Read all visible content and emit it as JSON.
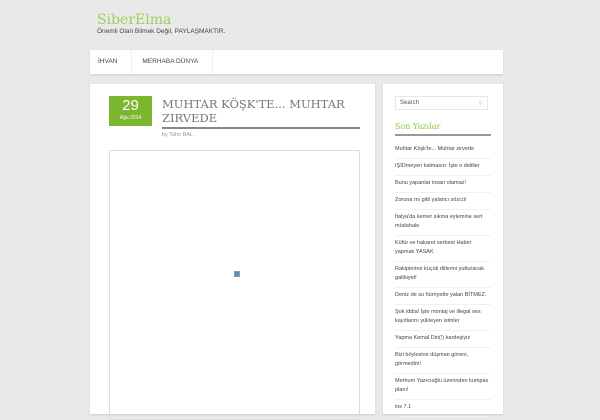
{
  "site": {
    "title": "SiberElma",
    "tagline": "Önemli Olan Bilmek Değil, PAYLAŞMAKTIR."
  },
  "nav": [
    "İHVAN",
    "MERHABA DÜNYA"
  ],
  "post": {
    "day": "29",
    "month_year": "Ağu 2014",
    "title": "MUHTAR KÖŞK'TE... MUHTAR ZIRVEDE",
    "byline": "by Tahir BAL"
  },
  "sidebar": {
    "search_placeholder": "Search",
    "widget_title": "Son Yazılar",
    "items": [
      "Muhtar Köşk'te... Muhtar zirvede",
      "IŞİDmeyen kalmasın: İşte o deliller",
      "Bunu yapanlar insan olamaz!",
      "Zoruna mı gitti yalancı sözcü!",
      "İtalya'da kemer sıkma eylemine sert müdahale",
      "Küfür ve hakaret serbest Haber yapmak YASAK",
      "Rakiplerine küçük dillerini yutturacak galibiyet!",
      "Deniz de su hürriyette yalan BİTMEZ.",
      "Şok iddia! İşte montaj ve illegal ses kayıtlarını yükleyen isimler",
      "Yapma Kemal Din(!) kardeşiyiz",
      "Bizi böylesine düşman göreni, görmedim!",
      "Merhum Yazıcıoğlu üzerinden kumpas planı!",
      "ios 7.1"
    ]
  }
}
